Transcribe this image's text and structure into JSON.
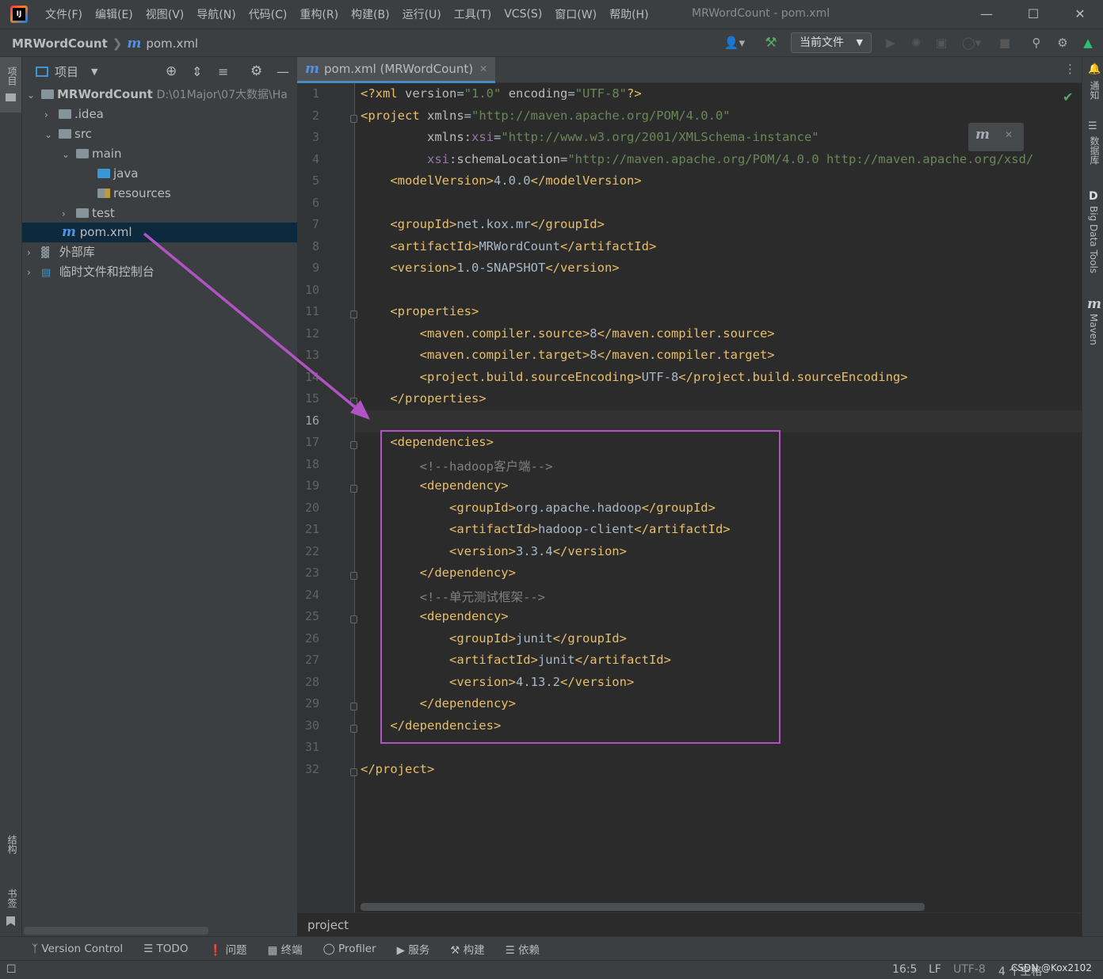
{
  "menubar": {
    "items": [
      "文件(F)",
      "编辑(E)",
      "视图(V)",
      "导航(N)",
      "代码(C)",
      "重构(R)",
      "构建(B)",
      "运行(U)",
      "工具(T)",
      "VCS(S)",
      "窗口(W)",
      "帮助(H)"
    ],
    "title": "MRWordCount - pom.xml"
  },
  "navbar": {
    "project": "MRWordCount",
    "file": "pom.xml",
    "run_config": "当前文件"
  },
  "left_strip": {
    "project_tab": "项目",
    "structure_tab": "结构",
    "bookmarks_tab": "书签"
  },
  "right_strip": {
    "notifications": "通知",
    "database": "数据库",
    "bigdata": "Big Data Tools",
    "maven": "Maven"
  },
  "project_panel": {
    "title": "项目",
    "tree": [
      {
        "label": "MRWordCount",
        "path": "D:\\01Major\\07大数据\\Ha",
        "depth": 0
      },
      {
        "label": ".idea",
        "depth": 1
      },
      {
        "label": "src",
        "depth": 1
      },
      {
        "label": "main",
        "depth": 2
      },
      {
        "label": "java",
        "depth": 3
      },
      {
        "label": "resources",
        "depth": 3
      },
      {
        "label": "test",
        "depth": 2
      },
      {
        "label": "pom.xml",
        "depth": 1
      },
      {
        "label": "外部库",
        "depth": 0
      },
      {
        "label": "临时文件和控制台",
        "depth": 0
      }
    ]
  },
  "editor": {
    "tab_label": "pom.xml (MRWordCount)",
    "breadcrumb": "project",
    "line_count": 32
  },
  "bottombar": {
    "items": [
      "Version Control",
      "TODO",
      "问题",
      "终端",
      "Profiler",
      "服务",
      "构建",
      "依赖"
    ]
  },
  "statusbar": {
    "position": "16:5",
    "line_sep": "LF",
    "encoding": "UTF-8",
    "indent": "4 个空格",
    "watermark": "CSDN @Kox2102"
  },
  "colors": {
    "highlight_box": "#b153c5",
    "arrow": "#b153c5",
    "accent": "#4a88c7"
  }
}
